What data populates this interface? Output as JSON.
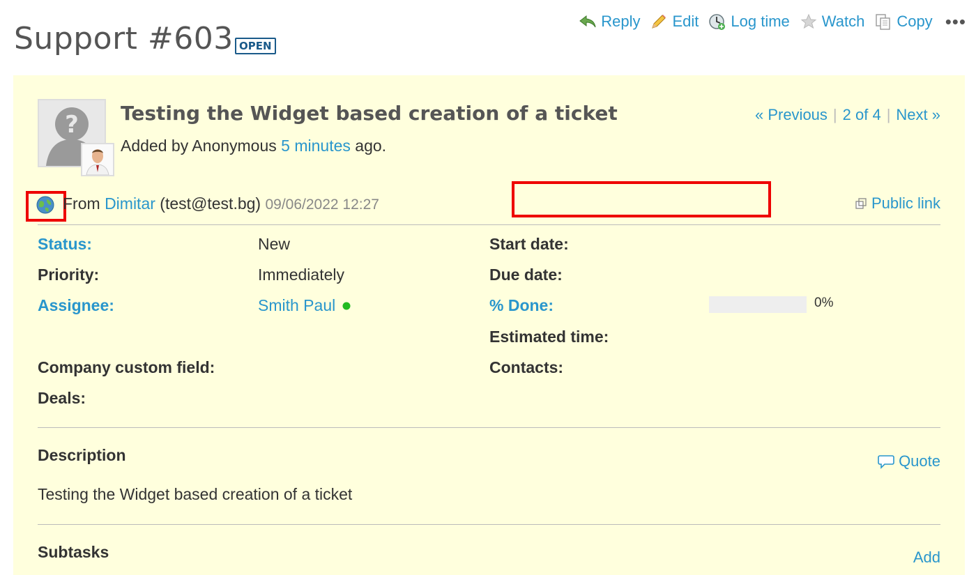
{
  "header": {
    "title": "Support #603",
    "status_badge": "OPEN"
  },
  "toolbar": {
    "reply": "Reply",
    "edit": "Edit",
    "log_time": "Log time",
    "watch": "Watch",
    "copy": "Copy",
    "more": "•••"
  },
  "issue": {
    "subject": "Testing the Widget based creation of a ticket",
    "added_by_prefix": "Added by Anonymous",
    "added_ago_link": "5 minutes",
    "added_suffix": "ago.",
    "nav": {
      "previous": "« Previous",
      "position": "2 of 4",
      "next": "Next »",
      "sep": "|"
    },
    "from_label": "From",
    "from_name": "Dimitar",
    "from_email": "(test@test.bg)",
    "from_date": "09/06/2022 12:27",
    "public_link": "Public link"
  },
  "attributes": {
    "status_label": "Status:",
    "status_value": "New",
    "priority_label": "Priority:",
    "priority_value": "Immediately",
    "assignee_label": "Assignee:",
    "assignee_value": "Smith Paul",
    "company_label": "Company custom field:",
    "deals_label": "Deals:",
    "start_label": "Start date:",
    "due_label": "Due date:",
    "done_label": "% Done:",
    "done_value": "0%",
    "done_fraction": 0,
    "estimated_label": "Estimated time:",
    "contacts_label": "Contacts:"
  },
  "description": {
    "title": "Description",
    "quote": "Quote",
    "text": "Testing the Widget based creation of a ticket"
  },
  "subtasks": {
    "title": "Subtasks",
    "add": "Add"
  },
  "colors": {
    "link": "#2996cc",
    "issue_bg": "#ffffdd",
    "highlight": "#ee0000",
    "online": "#22bb22"
  }
}
